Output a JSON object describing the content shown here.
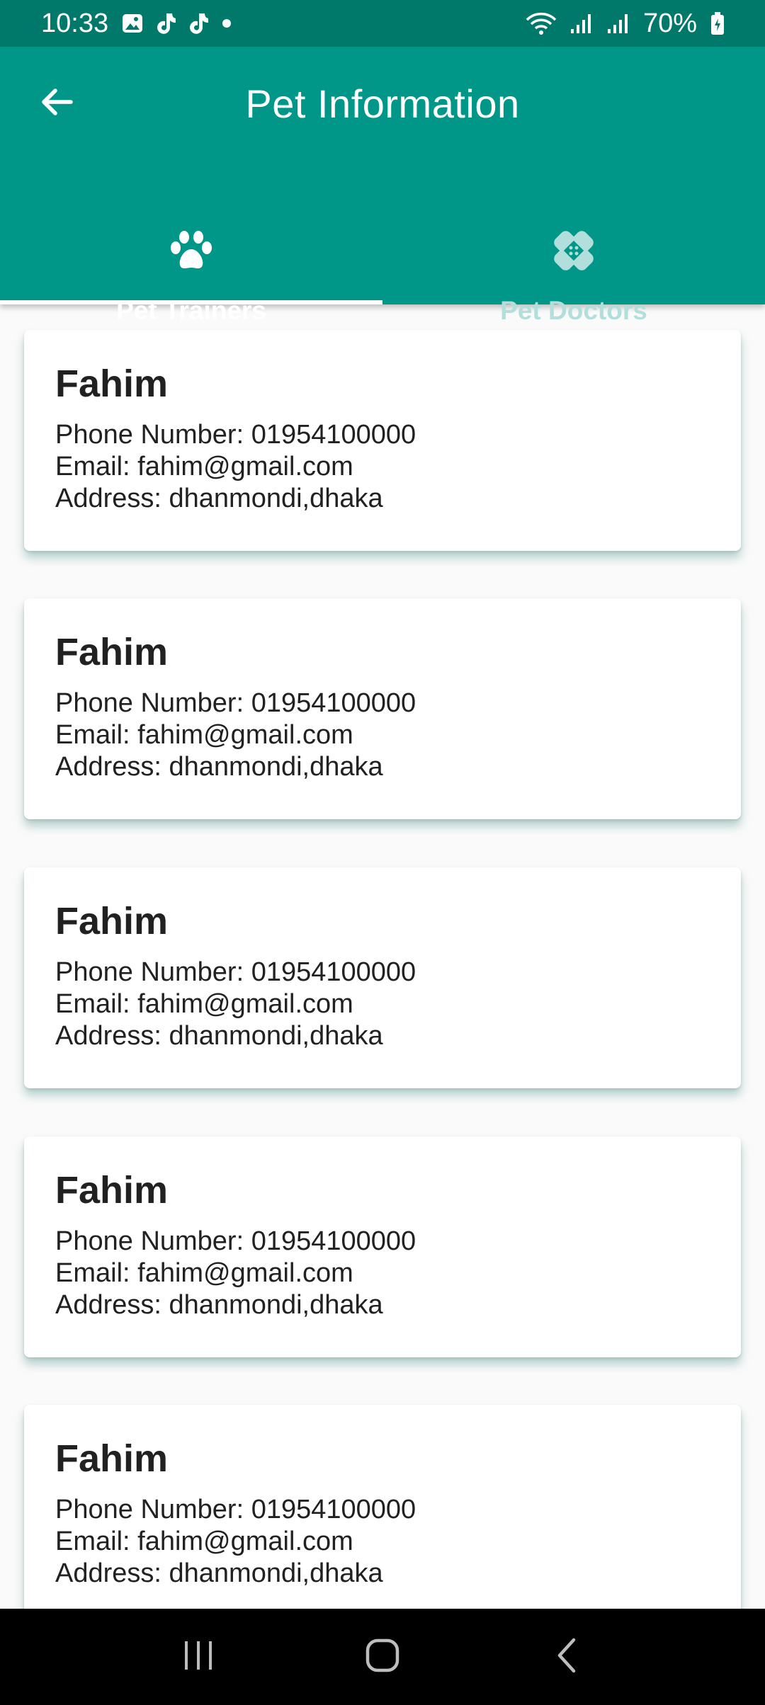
{
  "status_bar": {
    "time": "10:33",
    "battery": "70%",
    "icons": [
      "gallery-icon",
      "tiktok-icon",
      "tiktok-icon",
      "dot-icon",
      "wifi-icon",
      "signal-icon",
      "signal-icon",
      "battery-icon"
    ]
  },
  "header": {
    "title": "Pet Information",
    "back_icon": "arrow-left-icon"
  },
  "tabs": [
    {
      "label": "Pet Trainers",
      "icon": "paw-icon",
      "active": true
    },
    {
      "label": "Pet Doctors",
      "icon": "bandage-icon",
      "active": false
    }
  ],
  "cards": [
    {
      "name": "Fahim",
      "phone": "Phone Number: 01954100000",
      "email": "Email: fahim@gmail.com",
      "address": "Address: dhanmondi,dhaka"
    },
    {
      "name": "Fahim",
      "phone": "Phone Number: 01954100000",
      "email": "Email: fahim@gmail.com",
      "address": "Address: dhanmondi,dhaka"
    },
    {
      "name": "Fahim",
      "phone": "Phone Number: 01954100000",
      "email": "Email: fahim@gmail.com",
      "address": "Address: dhanmondi,dhaka"
    },
    {
      "name": "Fahim",
      "phone": "Phone Number: 01954100000",
      "email": "Email: fahim@gmail.com",
      "address": "Address: dhanmondi,dhaka"
    },
    {
      "name": "Fahim",
      "phone": "Phone Number: 01954100000",
      "email": "Email: fahim@gmail.com",
      "address": "Address: dhanmondi,dhaka"
    }
  ],
  "nav_bar": {
    "icons": [
      "recent-apps-icon",
      "home-icon",
      "back-icon"
    ]
  },
  "colors": {
    "primary": "#009688",
    "primary_dark": "#00796b",
    "inactive_tab": "#b2dfdb",
    "text": "#212121"
  }
}
